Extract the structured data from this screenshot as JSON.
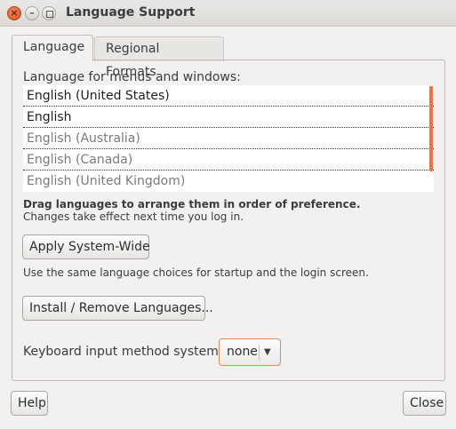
{
  "window": {
    "title": "Language Support",
    "close_glyph": "×",
    "minimize_glyph": "–"
  },
  "tabs": [
    {
      "label": "Language",
      "active": true
    },
    {
      "label": "Regional Formats",
      "active": false
    }
  ],
  "language_section": {
    "label": "Language for menus and windows:",
    "languages": [
      {
        "name": "English (United States)",
        "style": "primary"
      },
      {
        "name": "English",
        "style": "primary"
      },
      {
        "name": "English (Australia)",
        "style": "secondary"
      },
      {
        "name": "English (Canada)",
        "style": "secondary"
      },
      {
        "name": "English (United Kingdom)",
        "style": "secondary"
      }
    ],
    "drag_hint": "Drag languages to arrange them in order of preference.",
    "change_hint": "Changes take effect next time you log in."
  },
  "apply": {
    "button_label": "Apply System-Wide",
    "description": "Use the same language choices for startup and the login screen."
  },
  "install": {
    "button_label": "Install / Remove Languages..."
  },
  "keyboard": {
    "label": "Keyboard input method system:",
    "selected_value": "none",
    "arrow_glyph": "▼"
  },
  "footer": {
    "help_label": "Help",
    "close_label": "Close"
  },
  "colors": {
    "accent": "#e9753d",
    "window_bg": "#f2f1f0",
    "close_button": "#d8531e"
  },
  "icons": [
    "close-icon",
    "minimize-icon",
    "maximize-icon",
    "dropdown-arrow-icon"
  ]
}
